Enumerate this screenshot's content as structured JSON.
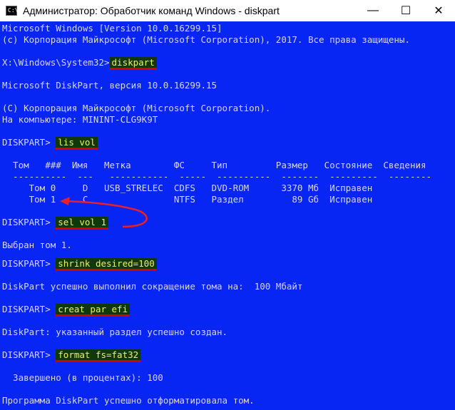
{
  "window": {
    "icon_text": "C:\\",
    "title": "Администратор: Обработчик команд Windows - diskpart",
    "minimize": "—",
    "maximize": "☐",
    "close": "✕"
  },
  "console": {
    "header1": "Microsoft Windows [Version 10.0.16299.15]",
    "header2": "(c) Корпорация Майкрософт (Microsoft Corporation), 2017. Все права защищены.",
    "prompt1": "X:\\Windows\\System32>",
    "cmd1": "diskpart",
    "dp_version": "Microsoft DiskPart, версия 10.0.16299.15",
    "dp_copyright": "(C) Корпорация Майкрософт (Microsoft Corporation).",
    "dp_computer": "На компьютере: MININT-CLG9K9T",
    "dp_prompt": "DISKPART> ",
    "cmd2": "lis vol",
    "table_header": "  Том   ###  Имя   Метка        ФС     Тип         Размер   Состояние  Сведения",
    "table_sep": "  ----------  ---   -----------  -----  ----------  -------  ---------  --------",
    "table_row1": "     Том 0     D   USB_STRELEC  CDFS   DVD-ROM      3370 Mб  Исправен",
    "table_row2": "     Том 1     C                NTFS   Раздел         89 Gб  Исправен",
    "cmd3": "sel vol 1",
    "out3": "Выбран том 1.",
    "cmd4": "shrink desired=100",
    "out4": "DiskPart успешно выполнил сокращение тома на:  100 Мбайт",
    "cmd5": "creat par efi",
    "out5": "DiskPart: указанный раздел успешно создан.",
    "cmd6": "format fs=fat32",
    "out6": "  Завершено (в процентах): 100",
    "out7": "Программа DiskPart успешно отформатировала том."
  },
  "colors": {
    "console_bg": "#0726f4",
    "console_text": "#d8d8d8",
    "highlight_bg": "#10380a",
    "highlight_text": "#f0f060",
    "underline": "#d40000"
  }
}
